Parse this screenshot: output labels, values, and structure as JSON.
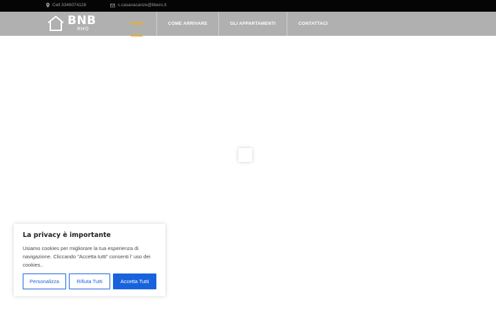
{
  "topbar": {
    "phone": "Cell 3346074128",
    "email": "c.casavacanze@libero.it"
  },
  "logo": {
    "title": "BNB",
    "subtitle": "RHO"
  },
  "nav": {
    "items": [
      {
        "label": "HOME"
      },
      {
        "label": "COME ARRIVARE"
      },
      {
        "label": "GLI APPARTAMENTI"
      },
      {
        "label": "CONTATTACI"
      }
    ]
  },
  "cookie_banner": {
    "title": "La privacy è importante",
    "text": "Usiamo cookies per migliorare la tua esperienza di navigazione. Cliccando \"Accetta tutti\" consenti l' uso dei cookies..",
    "buttons": {
      "customize": "Personalizza",
      "reject": "Rifiuta Tutti",
      "accept": "Accetta Tutti"
    }
  },
  "colors": {
    "accent": "#f2b01e",
    "button_blue": "#1863dc",
    "nav_bg": "#b0b0b0",
    "topbar_bg": "#050505"
  },
  "icons": {
    "phone": "map-pin-icon",
    "email": "envelope-icon",
    "logo": "house-outline-icon"
  }
}
